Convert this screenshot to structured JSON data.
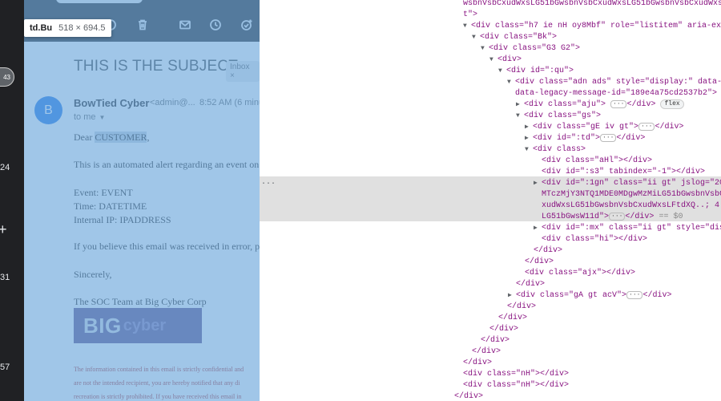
{
  "rail": {
    "items": [
      "43",
      "24",
      "+",
      "31",
      "57"
    ]
  },
  "tooltip": {
    "tag": "td.Bu",
    "size": "518 × 694.5"
  },
  "email": {
    "subject": "THIS IS THE SUBJECT",
    "label_chip": "Inbox ×",
    "sender_name": "BowTied Cyber",
    "sender_email": "<admin@...",
    "time": "8:52 AM (6 minu",
    "recipient": "to me",
    "greeting_prefix": "Dear ",
    "greeting_name": "CUSTOMER",
    "greeting_suffix": ",",
    "line1": "This is an automated alert regarding an event on yo",
    "event_label": "Event: EVENT",
    "time_label": "Time: DATETIME",
    "ip_label": "Internal IP: IPADDRESS",
    "line2": "If you believe this email was received in error, plea",
    "closing": "Sincerely,",
    "signature": "The SOC Team at Big Cyber Corp",
    "logo_big": "BIG",
    "logo_cyber": "cyber",
    "disclaimer1": "The information contained in this email is strictly confidential and",
    "disclaimer2": "are not the intended recipient, you are hereby notified that any di",
    "disclaimer3": "recreation is strictly prohibited. If you have received this email in"
  },
  "devtools": {
    "lines": [
      "wsbnVsbCxudWxsLG51bGwsbnVsbCxudWxsLG51bGwsbnVsbCxudWxsLG",
      "t\">",
      "<div class=\"h7 ie nH oy8Mbf\" role=\"listitem\" aria-expa",
      "<div class=\"Bk\">",
      "<div class=\"G3 G2\">",
      "<div>",
      "<div id=\":qu\">",
      "<div class=\"adn ads\" style=\"display:\" data-me",
      "data-legacy-message-id=\"189e4a75cd2537b2\">",
      "<div class=\"aju\">",
      "</div>",
      "flex",
      "<div class=\"gs\">",
      "<div class=\"gE iv gt\">",
      "<div id=\":td\">",
      "<div class>",
      "<div class=\"aHl\"></div>",
      "<div id=\":s3\" tabindex=\"-1\"></div>",
      "<div id=\":1gn\" class=\"ii gt\" jslog=\"202",
      "MTczMjY3NTQ1MDE0MDgwMzMiLG51bGwsbnVsbCx",
      "xudWxsLG51bGwsbnVsbCxudWxsLFtdXQ..; 4:W",
      "LG51bGwsW11d\">",
      "== $0",
      "<div id=\":mx\" class=\"ii gt\" style=\"disp",
      "<div class=\"hi\"></div>",
      "</div>",
      "<div class=\"ajx\"></div>",
      "<div class=\"gA gt acV\">",
      "<div class=\"nH\"></div>",
      "..."
    ]
  }
}
